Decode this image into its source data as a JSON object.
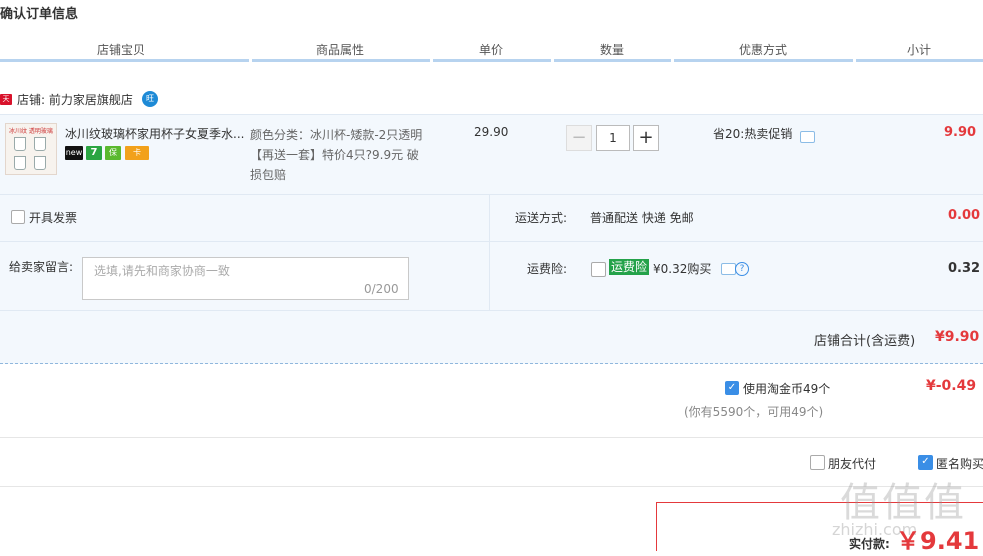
{
  "page": {
    "title": "确认订单信息"
  },
  "columns": [
    "店铺宝贝",
    "商品属性",
    "单价",
    "数量",
    "优惠方式",
    "小计"
  ],
  "shop": {
    "badge": "天猫",
    "label": "店铺: 前力家居旗舰店",
    "wangwang": "旺"
  },
  "item": {
    "name": "冰川纹玻璃杯家用杯子女夏季水...",
    "thumb_caption": "冰川纹 透明玻璃",
    "service_icons": [
      {
        "name": "tmall-new-icon",
        "label": "new",
        "color": "#111111"
      },
      {
        "name": "seven-days-return-icon",
        "label": "7",
        "color": "#2aa542"
      },
      {
        "name": "quality-guarantee-icon",
        "label": "保",
        "color": "#5ab92e"
      },
      {
        "name": "credit-card-icon",
        "label": "卡",
        "color": "#f2a11b"
      }
    ],
    "attr_line1": "颜色分类：冰川杯-矮款-2只透明",
    "attr_line2": "【再送一套】特价4只?9.9元 破",
    "attr_line3": "损包赔",
    "unit_price": "29.90",
    "qty_minus": "−",
    "quantity": "1",
    "qty_plus": "+",
    "promo": "省20:热卖促销",
    "subtotal": "9.90"
  },
  "invoice": {
    "label": "开具发票"
  },
  "shipping": {
    "label": "运送方式:",
    "value": "普通配送 快递 免邮",
    "fee": "0.00"
  },
  "message": {
    "label": "给卖家留言:",
    "placeholder": "选填,请先和商家协商一致",
    "count": "0/200"
  },
  "insurance": {
    "label": "运费险:",
    "badge": "运费险",
    "price": "¥0.32购买",
    "help": "?",
    "fee": "0.32"
  },
  "shop_total": {
    "label": "店铺合计(含运费)",
    "value": "¥9.90"
  },
  "coins": {
    "label": "使用淘金币49个",
    "value": "¥-0.49",
    "note": "(你有5590个，可用49个)"
  },
  "options": {
    "friend_pay": "朋友代付",
    "anonymous": "匿名购买"
  },
  "payment": {
    "label": "实付款:",
    "amount": "￥9.41"
  },
  "watermark": {
    "logo": "值值值",
    "url": "zhizhi.com"
  },
  "colors": {
    "accent": "#3a8ee6",
    "price_red": "#e4393c",
    "panel_bg": "#f3f8fd"
  }
}
